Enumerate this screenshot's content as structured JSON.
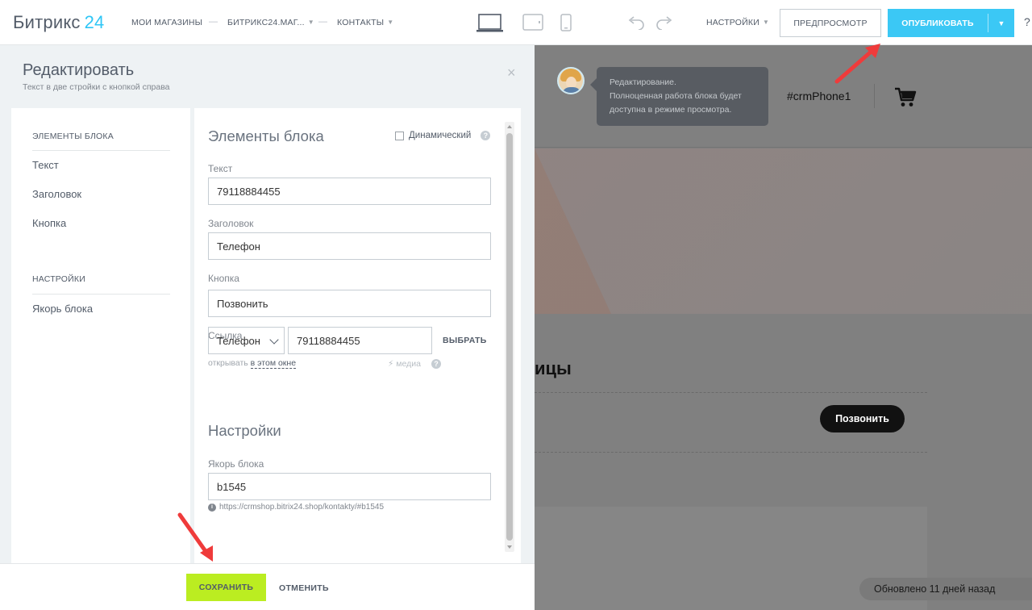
{
  "topbar": {
    "logo_text": "Битрикс",
    "logo_num": "24",
    "nav": {
      "my_shops": "МОИ МАГАЗИНЫ",
      "site": "БИТРИКС24.МАГ...",
      "contacts": "КОНТАКТЫ"
    },
    "separator": "—",
    "settings_label": "НАСТРОЙКИ",
    "preview_label": "ПРЕДПРОСМОТР",
    "publish_label": "ОПУБЛИКОВАТЬ",
    "help_label": "?"
  },
  "editor": {
    "title": "Редактировать",
    "subtitle": "Текст в две стройки с кнопкой справа",
    "close": "×",
    "nav": {
      "section1": "ЭЛЕМЕНТЫ БЛОКА",
      "items1": [
        "Текст",
        "Заголовок",
        "Кнопка"
      ],
      "section2": "НАСТРОЙКИ",
      "items2": [
        "Якорь блока"
      ]
    },
    "form": {
      "elements_title": "Элементы блока",
      "dynamic_label": "Динамический",
      "help_q": "?",
      "text_label": "Текст",
      "text_value": "79118884455",
      "heading_label": "Заголовок",
      "heading_value": "Телефон",
      "button_label": "Кнопка",
      "button_value": "Позвонить",
      "link_label": "Ссылка",
      "link_type": "Телефон",
      "link_value": "79118884455",
      "choose_label": "ВЫБРАТЬ",
      "open_prefix": "открывать",
      "open_target": "в этом окне",
      "media_label": "⚡ медиа",
      "settings_title": "Настройки",
      "anchor_label": "Якорь блока",
      "anchor_value": "b1545",
      "anchor_url": "https://crmshop.bitrix24.shop/kontakty/#b1545",
      "info_icon": "i"
    },
    "footer": {
      "save_label": "СОХРАНИТЬ",
      "cancel_label": "ОТМЕНИТЬ"
    }
  },
  "preview": {
    "tooltip_title": "Редактирование.",
    "tooltip_body": "Полноценная работа блока будет доступна в режиме просмотра.",
    "phone_placeholder": "#crmPhone1",
    "section_title": "ицы",
    "call_button": "Позвонить",
    "updated": "Обновлено 11 дней назад"
  },
  "colors": {
    "accent": "#3bc8f5",
    "save": "#bbed21",
    "arrow": "#ef3b3b"
  }
}
